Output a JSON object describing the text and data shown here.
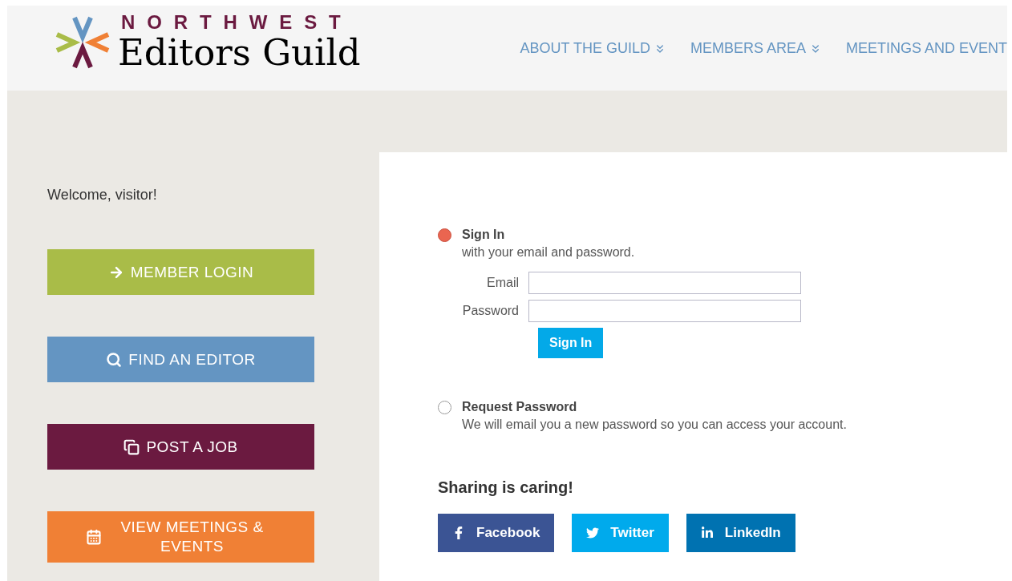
{
  "logo": {
    "top_line": "NORTHWEST",
    "name": "Editors Guild"
  },
  "nav": [
    {
      "label": "ABOUT THE GUILD",
      "dropdown": true
    },
    {
      "label": "MEMBERS AREA",
      "dropdown": true
    },
    {
      "label": "MEETINGS AND EVENT",
      "dropdown": false
    }
  ],
  "sidebar": {
    "welcome": "Welcome, visitor!",
    "buttons": [
      {
        "label": "MEMBER LOGIN",
        "kind": "arrow",
        "color": "#a9bc48"
      },
      {
        "label": "FIND AN EDITOR",
        "kind": "search",
        "color": "#6495c2"
      },
      {
        "label": "POST A JOB",
        "kind": "copy",
        "color": "#6b1a40"
      },
      {
        "label": "VIEW MEETINGS & EVENTS",
        "kind": "calendar",
        "color": "#f08035"
      }
    ]
  },
  "login": {
    "options": [
      {
        "title": "Sign In",
        "description": "with your email and password.",
        "selected": true
      },
      {
        "title": "Request Password",
        "description": "We will email you a new password so you can access your account.",
        "selected": false
      }
    ],
    "fields": [
      {
        "label": "Email"
      },
      {
        "label": "Password"
      }
    ],
    "submit": "Sign In"
  },
  "sharing": {
    "heading": "Sharing is caring!",
    "buttons": [
      {
        "label": "Facebook",
        "kind": "facebook",
        "color": "#3b5494"
      },
      {
        "label": "Twitter",
        "kind": "twitter",
        "color": "#00aaec"
      },
      {
        "label": "LinkedIn",
        "kind": "linkedin",
        "color": "#0072b1"
      }
    ]
  }
}
